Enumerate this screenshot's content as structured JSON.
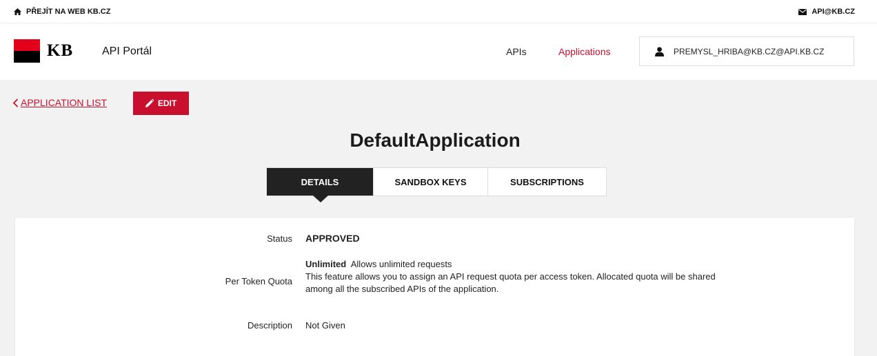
{
  "topbar": {
    "left_link": "PŘEJÍT NA WEB KB.CZ",
    "left_icon": "home-icon",
    "right_link": "API@KB.CZ",
    "right_icon": "mail-icon"
  },
  "header": {
    "logo_text": "KB",
    "portal_name": "API Portál",
    "nav": {
      "apis": "APIs",
      "applications": "Applications"
    },
    "user_email": "PREMYSL_HRIBA@KB.CZ@API.KB.CZ",
    "user_icon": "user-icon"
  },
  "actions": {
    "back_label": "APPLICATION LIST",
    "edit_label": "EDIT"
  },
  "app": {
    "title": "DefaultApplication"
  },
  "tabs": [
    {
      "label": "DETAILS",
      "active": true
    },
    {
      "label": "SANDBOX KEYS",
      "active": false
    },
    {
      "label": "SUBSCRIPTIONS",
      "active": false
    }
  ],
  "details": {
    "status_label": "Status",
    "status_value": "APPROVED",
    "quota_label": "Per Token Quota",
    "quota_name": "Unlimited",
    "quota_short": "Allows unlimited requests",
    "quota_desc": "This feature allows you to assign an API request quota per access token. Allocated quota will be shared among all the subscribed APIs of the application.",
    "description_label": "Description",
    "description_value": "Not Given"
  },
  "colors": {
    "brand_red": "#c8102e",
    "logo_red": "#e2001a",
    "dark": "#222222",
    "content_bg": "#f2f2f2"
  }
}
